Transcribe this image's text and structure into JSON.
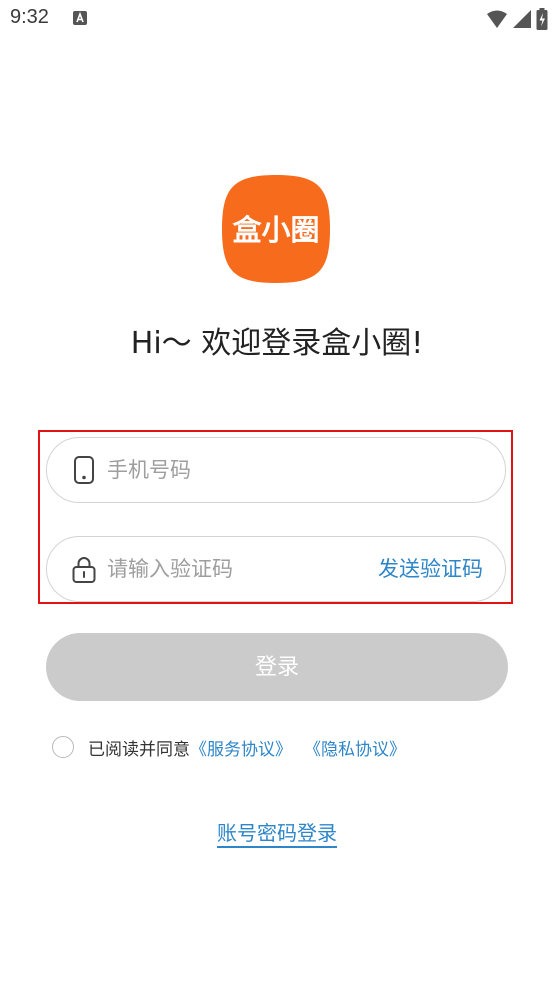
{
  "status_bar": {
    "time": "9:32"
  },
  "logo": {
    "text": "盒小圈",
    "color": "#f66b1c"
  },
  "welcome": {
    "text": "Hi～ 欢迎登录盒小圈!"
  },
  "phone_field": {
    "placeholder": "手机号码",
    "icon": "phone-icon"
  },
  "code_field": {
    "placeholder": "请输入验证码",
    "icon": "lock-icon",
    "send_label": "发送验证码"
  },
  "login_button": {
    "label": "登录"
  },
  "agreement": {
    "prefix": "已阅读并同意",
    "service": "《服务协议》",
    "privacy": "《隐私协议》"
  },
  "password_login": {
    "label": "账号密码登录"
  },
  "colors": {
    "accent": "#2e86c9",
    "brand": "#f66b1c",
    "highlight": "#e01414",
    "disabled_button": "#cbcbcb"
  }
}
